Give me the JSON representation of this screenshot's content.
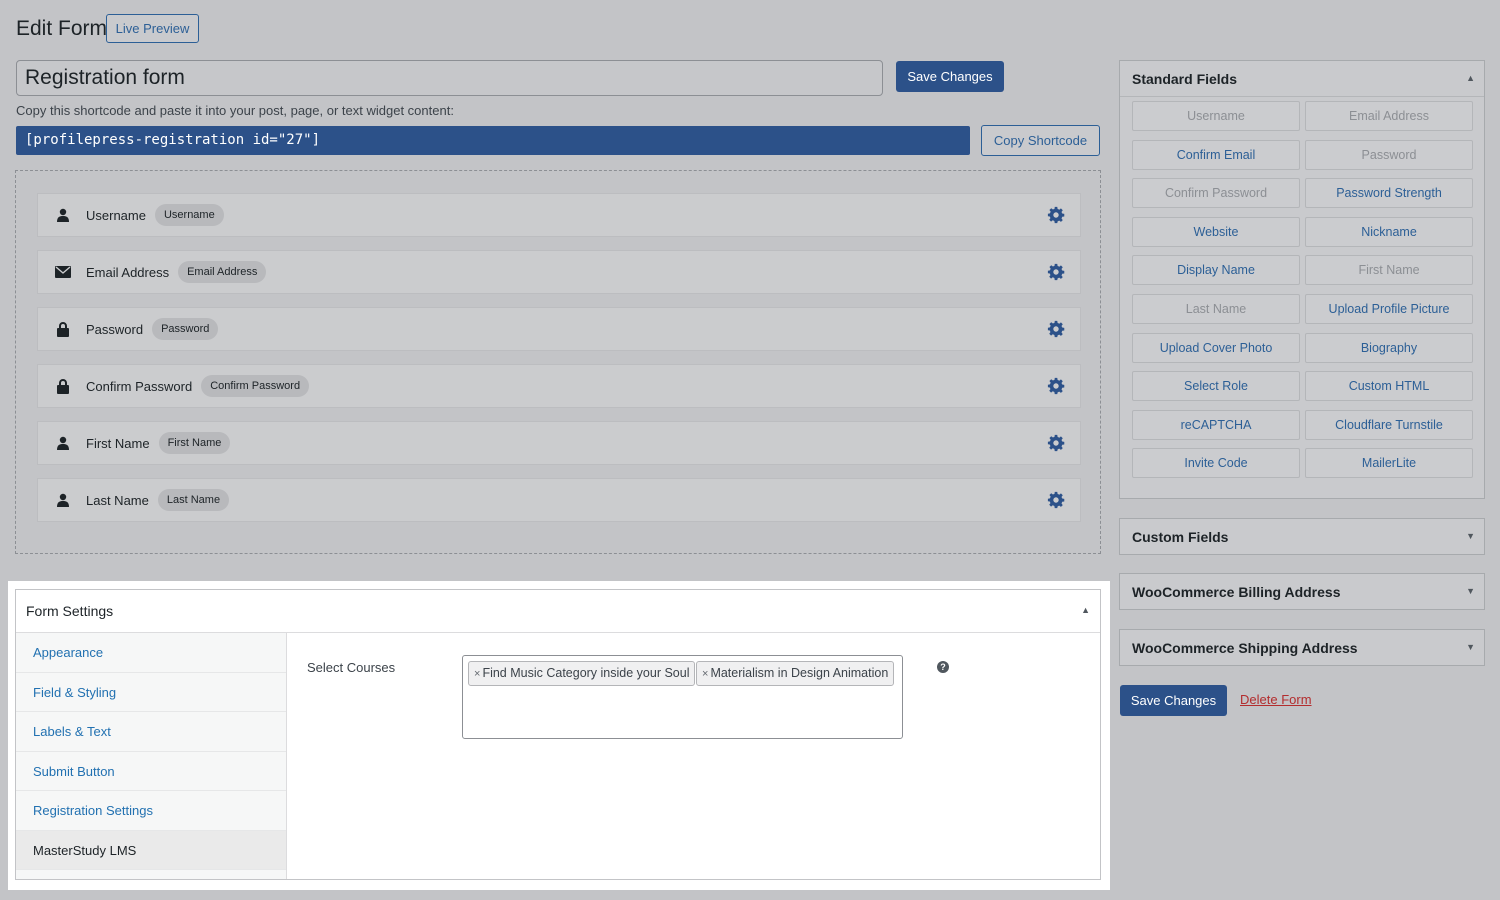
{
  "header": {
    "title": "Edit Form",
    "live_preview": "Live Preview"
  },
  "form": {
    "name": "Registration form",
    "save_label": "Save Changes",
    "shortcode_hint": "Copy this shortcode and paste it into your post, page, or text widget content:",
    "shortcode": "[profilepress-registration id=\"27\"]",
    "copy_shortcode": "Copy Shortcode"
  },
  "builder": {
    "fields": [
      {
        "label": "Username",
        "badge": "Username",
        "icon": "user-icon"
      },
      {
        "label": "Email Address",
        "badge": "Email Address",
        "icon": "envelope-icon"
      },
      {
        "label": "Password",
        "badge": "Password",
        "icon": "lock-icon"
      },
      {
        "label": "Confirm Password",
        "badge": "Confirm Password",
        "icon": "lock-icon"
      },
      {
        "label": "First Name",
        "badge": "First Name",
        "icon": "user-icon"
      },
      {
        "label": "Last Name",
        "badge": "Last Name",
        "icon": "user-icon"
      }
    ]
  },
  "settings": {
    "title": "Form Settings",
    "nav": [
      {
        "label": "Appearance"
      },
      {
        "label": "Field & Styling"
      },
      {
        "label": "Labels & Text"
      },
      {
        "label": "Submit Button"
      },
      {
        "label": "Registration Settings"
      },
      {
        "label": "MasterStudy LMS",
        "active": true
      }
    ],
    "select_courses_label": "Select Courses",
    "selected_courses": [
      "Find Music Category inside your Soul",
      "Materialism in Design Animation"
    ],
    "remove_glyph": "×"
  },
  "sidebar": {
    "standard_fields_title": "Standard Fields",
    "standard_fields": [
      {
        "label": "Username",
        "disabled": true
      },
      {
        "label": "Email Address",
        "disabled": true
      },
      {
        "label": "Confirm Email",
        "disabled": false
      },
      {
        "label": "Password",
        "disabled": true
      },
      {
        "label": "Confirm Password",
        "disabled": true
      },
      {
        "label": "Password Strength",
        "disabled": false
      },
      {
        "label": "Website",
        "disabled": false
      },
      {
        "label": "Nickname",
        "disabled": false
      },
      {
        "label": "Display Name",
        "disabled": false
      },
      {
        "label": "First Name",
        "disabled": true
      },
      {
        "label": "Last Name",
        "disabled": true
      },
      {
        "label": "Upload Profile Picture",
        "disabled": false
      },
      {
        "label": "Upload Cover Photo",
        "disabled": false
      },
      {
        "label": "Biography",
        "disabled": false
      },
      {
        "label": "Select Role",
        "disabled": false
      },
      {
        "label": "Custom HTML",
        "disabled": false
      },
      {
        "label": "reCAPTCHA",
        "disabled": false
      },
      {
        "label": "Cloudflare Turnstile",
        "disabled": false
      },
      {
        "label": "Invite Code",
        "disabled": false
      },
      {
        "label": "MailerLite",
        "disabled": false
      }
    ],
    "custom_fields_title": "Custom Fields",
    "billing_title": "WooCommerce Billing Address",
    "shipping_title": "WooCommerce Shipping Address",
    "save_label": "Save Changes",
    "delete_label": "Delete Form"
  },
  "colors": {
    "primary": "#2c5189",
    "link": "#2c5f96",
    "danger": "#b32d2e",
    "background": "#c3c4c7"
  }
}
